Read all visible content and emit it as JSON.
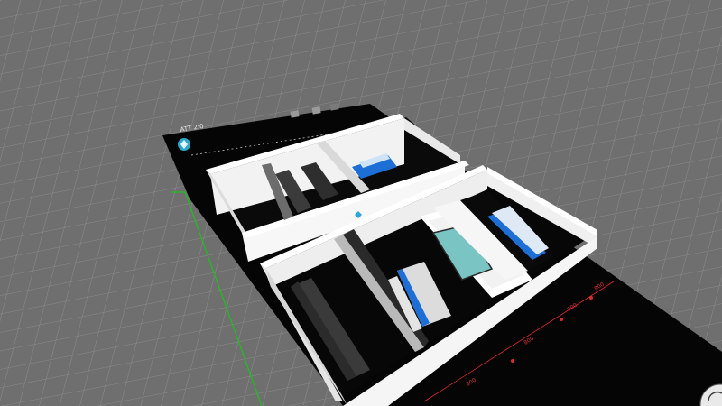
{
  "scene": {
    "type": "3d-floorplan-viewer",
    "background_color": "#6f6f6f",
    "grid_color": "#8a8a8a",
    "floor_color": "#050505",
    "wall_color": "#f4f4f4",
    "accent_blue": "#1d6fd6",
    "screen_teal": "#7bc4c4",
    "boundary_green": "#18c418",
    "dimension_red": "#d92b2b"
  },
  "hud": {
    "status_text": "ATT 2:0",
    "icons": [
      "compass-icon",
      "settings-icon",
      "layers-icon",
      "more-icon"
    ]
  },
  "dimensions": {
    "labels": [
      "800",
      "800",
      "800",
      "800"
    ]
  },
  "corner_icon": "rotate-view-icon"
}
